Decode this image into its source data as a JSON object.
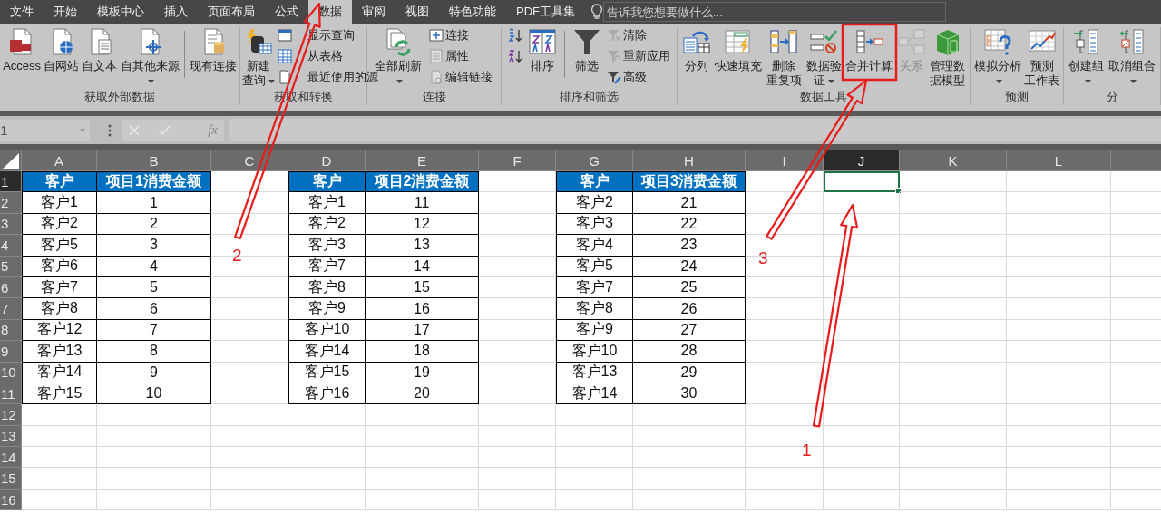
{
  "menu_tabs": [
    {
      "label": "文件",
      "selected": false
    },
    {
      "label": "开始",
      "selected": false
    },
    {
      "label": "模板中心",
      "selected": false
    },
    {
      "label": "插入",
      "selected": false
    },
    {
      "label": "页面布局",
      "selected": false
    },
    {
      "label": "公式",
      "selected": false
    },
    {
      "label": "数据",
      "selected": true
    },
    {
      "label": "审阅",
      "selected": false
    },
    {
      "label": "视图",
      "selected": false
    },
    {
      "label": "特色功能",
      "selected": false
    },
    {
      "label": "PDF工具集",
      "selected": false
    }
  ],
  "tell_me": {
    "placeholder": "告诉我您想要做什么..."
  },
  "ribbon_groups": [
    {
      "label": "获取外部数据",
      "items": [
        {
          "kind": "large",
          "lines": [
            "Access"
          ],
          "dropdown": false,
          "disabled": false
        },
        {
          "kind": "large",
          "lines": [
            "自网站"
          ],
          "dropdown": false,
          "disabled": false
        },
        {
          "kind": "large",
          "lines": [
            "自文本"
          ],
          "dropdown": false,
          "disabled": false
        },
        {
          "kind": "large",
          "lines": [
            "自其他来源"
          ],
          "dropdown": true,
          "disabled": false
        },
        {
          "kind": "separator"
        },
        {
          "kind": "large",
          "lines": [
            "现有连接"
          ],
          "dropdown": false,
          "disabled": false
        }
      ]
    },
    {
      "label": "获取和转换",
      "items": [
        {
          "kind": "large",
          "lines": [
            "新建",
            "查询"
          ],
          "dropdown": true,
          "disabled": false
        },
        {
          "kind": "stack",
          "items": [
            {
              "label": "显示查询",
              "disabled": false
            },
            {
              "label": "从表格",
              "disabled": false
            },
            {
              "label": "最近使用的源",
              "disabled": false
            }
          ]
        }
      ]
    },
    {
      "label": "连接",
      "items": [
        {
          "kind": "large",
          "lines": [
            "全部刷新"
          ],
          "dropdown": true,
          "disabled": false
        },
        {
          "kind": "stack",
          "items": [
            {
              "label": "连接",
              "disabled": false
            },
            {
              "label": "属性",
              "disabled": true
            },
            {
              "label": "编辑链接",
              "disabled": true
            }
          ]
        }
      ]
    },
    {
      "label": "排序和筛选",
      "items": [
        {
          "kind": "stack",
          "items": [
            {
              "disabled": false
            },
            {
              "disabled": false
            }
          ]
        },
        {
          "kind": "large",
          "lines": [
            "排序"
          ],
          "dropdown": false,
          "disabled": false
        },
        {
          "kind": "separator"
        },
        {
          "kind": "large",
          "lines": [
            "筛选"
          ],
          "dropdown": false,
          "disabled": false
        },
        {
          "kind": "stack",
          "items": [
            {
              "label": "清除",
              "disabled": true
            },
            {
              "label": "重新应用",
              "disabled": true
            },
            {
              "label": "高级",
              "disabled": false
            }
          ]
        }
      ]
    },
    {
      "label": "数据工具",
      "items": [
        {
          "kind": "large",
          "lines": [
            "分列"
          ],
          "dropdown": false,
          "disabled": false
        },
        {
          "kind": "large",
          "lines": [
            "快速填充"
          ],
          "dropdown": false,
          "disabled": false
        },
        {
          "kind": "large",
          "lines": [
            "删除",
            "重复项"
          ],
          "dropdown": false,
          "disabled": false
        },
        {
          "kind": "large",
          "lines": [
            "数据验",
            "证"
          ],
          "dropdown": true,
          "disabled": false
        },
        {
          "kind": "large",
          "lines": [
            "合并计算"
          ],
          "dropdown": false,
          "disabled": false
        },
        {
          "kind": "large",
          "lines": [
            "关系"
          ],
          "dropdown": false,
          "disabled": true
        },
        {
          "kind": "large",
          "lines": [
            "管理数",
            "据模型"
          ],
          "dropdown": false,
          "disabled": false
        }
      ]
    },
    {
      "label": "预测",
      "items": [
        {
          "kind": "large",
          "lines": [
            "模拟分析"
          ],
          "dropdown": true,
          "disabled": false
        },
        {
          "kind": "large",
          "lines": [
            "预测",
            "工作表"
          ],
          "dropdown": false,
          "disabled": false
        }
      ]
    },
    {
      "label": "分",
      "items": [
        {
          "kind": "large",
          "lines": [
            "创建组"
          ],
          "dropdown": true,
          "disabled": false
        },
        {
          "kind": "large",
          "lines": [
            "取消组合"
          ],
          "dropdown": true,
          "disabled": false
        }
      ]
    }
  ],
  "formula_bar": {
    "name_box": "1",
    "function_label": "fx"
  },
  "sheet": {
    "columns": [
      {
        "label": "A",
        "selected": false
      },
      {
        "label": "B",
        "selected": false
      },
      {
        "label": "C",
        "selected": false
      },
      {
        "label": "D",
        "selected": false
      },
      {
        "label": "E",
        "selected": false
      },
      {
        "label": "F",
        "selected": false
      },
      {
        "label": "G",
        "selected": false
      },
      {
        "label": "H",
        "selected": false
      },
      {
        "label": "I",
        "selected": false
      },
      {
        "label": "J",
        "selected": true
      },
      {
        "label": "K",
        "selected": false
      },
      {
        "label": "L",
        "selected": false
      }
    ],
    "rows": [
      {
        "label": "1",
        "selected": true
      },
      {
        "label": "2",
        "selected": false
      },
      {
        "label": "3",
        "selected": false
      },
      {
        "label": "4",
        "selected": false
      },
      {
        "label": "5",
        "selected": false
      },
      {
        "label": "6",
        "selected": false
      },
      {
        "label": "7",
        "selected": false
      },
      {
        "label": "8",
        "selected": false
      },
      {
        "label": "9",
        "selected": false
      },
      {
        "label": "10",
        "selected": false
      },
      {
        "label": "11",
        "selected": false
      },
      {
        "label": "12",
        "selected": false
      },
      {
        "label": "13",
        "selected": false
      },
      {
        "label": "14",
        "selected": false
      },
      {
        "label": "15",
        "selected": false
      },
      {
        "label": "16",
        "selected": false
      }
    ],
    "tables": [
      {
        "headers": [
          "客户",
          "项目1消费金额"
        ],
        "rows": [
          [
            "客户1",
            "1"
          ],
          [
            "客户2",
            "2"
          ],
          [
            "客户5",
            "3"
          ],
          [
            "客户6",
            "4"
          ],
          [
            "客户7",
            "5"
          ],
          [
            "客户8",
            "6"
          ],
          [
            "客户12",
            "7"
          ],
          [
            "客户13",
            "8"
          ],
          [
            "客户14",
            "9"
          ],
          [
            "客户15",
            "10"
          ]
        ]
      },
      {
        "headers": [
          "客户",
          "项目2消费金额"
        ],
        "rows": [
          [
            "客户1",
            "11"
          ],
          [
            "客户2",
            "12"
          ],
          [
            "客户3",
            "13"
          ],
          [
            "客户7",
            "14"
          ],
          [
            "客户8",
            "15"
          ],
          [
            "客户9",
            "16"
          ],
          [
            "客户10",
            "17"
          ],
          [
            "客户14",
            "18"
          ],
          [
            "客户15",
            "19"
          ],
          [
            "客户16",
            "20"
          ]
        ]
      },
      {
        "headers": [
          "客户",
          "项目3消费金额"
        ],
        "rows": [
          [
            "客户2",
            "21"
          ],
          [
            "客户3",
            "22"
          ],
          [
            "客户4",
            "23"
          ],
          [
            "客户5",
            "24"
          ],
          [
            "客户7",
            "25"
          ],
          [
            "客户8",
            "26"
          ],
          [
            "客户9",
            "27"
          ],
          [
            "客户10",
            "28"
          ],
          [
            "客户13",
            "29"
          ],
          [
            "客户14",
            "30"
          ]
        ]
      }
    ]
  },
  "annotations": [
    {
      "label": "2"
    },
    {
      "label": "3"
    },
    {
      "label": "1"
    }
  ]
}
